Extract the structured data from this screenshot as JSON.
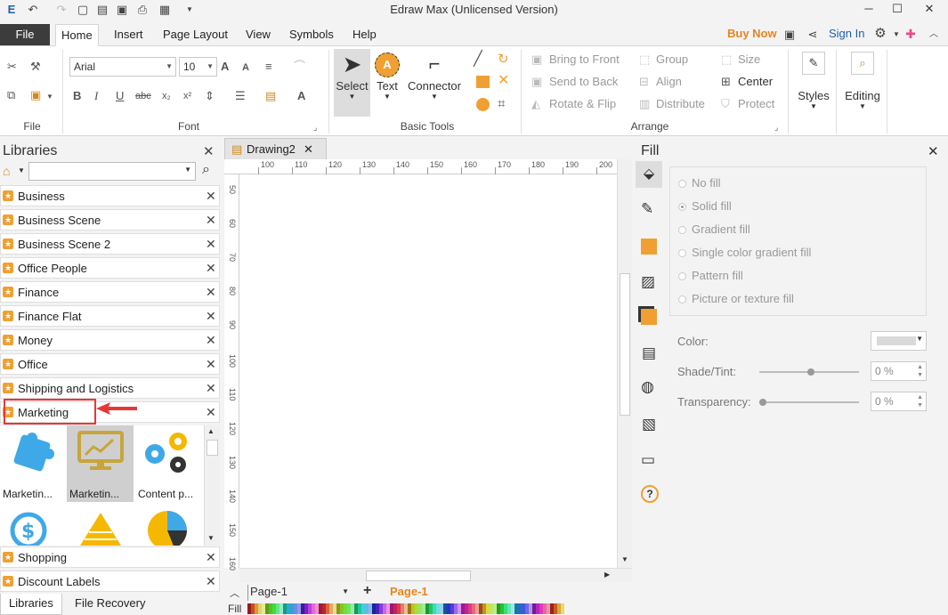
{
  "window": {
    "title": "Edraw Max (Unlicensed Version)"
  },
  "menu": {
    "file": "File",
    "tabs": [
      "Home",
      "Insert",
      "Page Layout",
      "View",
      "Symbols",
      "Help"
    ],
    "buy_now": "Buy Now",
    "sign_in": "Sign In"
  },
  "ribbon": {
    "groups": {
      "file": "File",
      "font": "Font",
      "basic_tools": "Basic Tools",
      "arrange": "Arrange"
    },
    "font_name": "Arial",
    "font_size": "10",
    "tools": {
      "select": "Select",
      "text": "Text",
      "connector": "Connector"
    },
    "arrange": {
      "bring_front": "Bring to Front",
      "send_back": "Send to Back",
      "rotate_flip": "Rotate & Flip",
      "group": "Group",
      "align": "Align",
      "distribute": "Distribute",
      "size": "Size",
      "center": "Center",
      "protect": "Protect"
    },
    "styles": "Styles",
    "editing": "Editing"
  },
  "libraries": {
    "title": "Libraries",
    "categories": [
      "Business",
      "Business Scene",
      "Business Scene 2",
      "Office People",
      "Finance",
      "Finance Flat",
      "Money",
      "Office",
      "Shipping and Logistics",
      "Marketing"
    ],
    "thumbs": [
      "Marketin...",
      "Marketin...",
      "Content p..."
    ],
    "bottom_categories": [
      "Shopping",
      "Discount Labels"
    ],
    "bottom_tabs": [
      "Libraries",
      "File Recovery"
    ]
  },
  "document": {
    "tab": "Drawing2",
    "ruler_h": [
      "100",
      "110",
      "120",
      "130",
      "140",
      "150",
      "160",
      "170",
      "180",
      "190",
      "200"
    ],
    "ruler_v": [
      "50",
      "60",
      "70",
      "80",
      "90",
      "100",
      "110",
      "120",
      "130",
      "140",
      "150",
      "160"
    ],
    "page_select": "Page-1",
    "page_tab": "Page-1",
    "fill_label": "Fill"
  },
  "fill_panel": {
    "title": "Fill",
    "options": [
      "No fill",
      "Solid fill",
      "Gradient fill",
      "Single color gradient fill",
      "Pattern fill",
      "Picture or texture fill"
    ],
    "color_label": "Color:",
    "shade_label": "Shade/Tint:",
    "transparency_label": "Transparency:",
    "shade_value": "0 %",
    "transparency_value": "0 %"
  },
  "colors": {
    "accent": "#f0a032",
    "file_tab": "#3c3c3c",
    "buy_now": "#e8841c",
    "highlight": "#e53935"
  }
}
